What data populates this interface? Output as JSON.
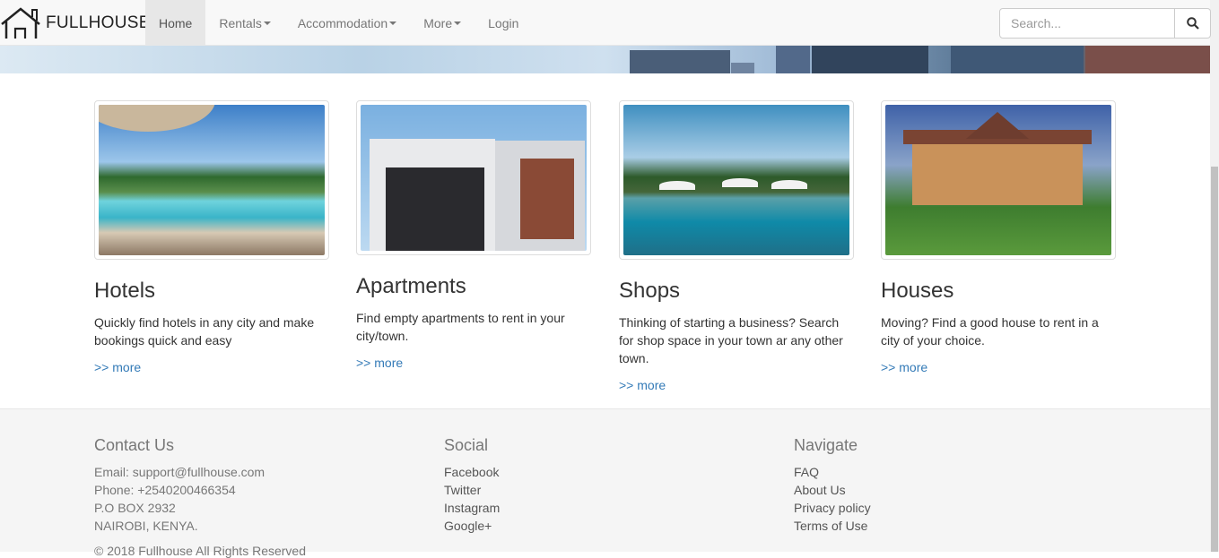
{
  "brand": {
    "name": "FULLHOUSE",
    "icon": "house-outline-icon"
  },
  "nav": {
    "items": [
      {
        "label": "Home",
        "active": true,
        "dropdown": false
      },
      {
        "label": "Rentals",
        "active": false,
        "dropdown": true
      },
      {
        "label": "Accommodation",
        "active": false,
        "dropdown": true
      },
      {
        "label": "More",
        "active": false,
        "dropdown": true
      },
      {
        "label": "Login",
        "active": false,
        "dropdown": false
      }
    ]
  },
  "search": {
    "placeholder": "Search...",
    "value": "",
    "icon": "search-icon"
  },
  "cards": [
    {
      "title": "Hotels",
      "text": "Quickly find hotels in any city and make bookings quick and easy",
      "link": ">> more",
      "image": "hotel-pool-photo"
    },
    {
      "title": "Apartments",
      "text": "Find empty apartments to rent in your city/town.",
      "link": ">> more",
      "image": "modern-apartment-photo"
    },
    {
      "title": "Shops",
      "text": "Thinking of starting a business? Search for shop space in your town ar any other town.",
      "link": ">> more",
      "image": "resort-pool-photo"
    },
    {
      "title": "Houses",
      "text": "Moving? Find a good house to rent in a city of your choice.",
      "link": ">> more",
      "image": "brick-house-photo"
    }
  ],
  "footer": {
    "contact": {
      "heading": "Contact Us",
      "lines": [
        "Email: support@fullhouse.com",
        "Phone: +2540200466354",
        "P.O BOX 2932",
        "NAIROBI, KENYA."
      ]
    },
    "social": {
      "heading": "Social",
      "links": [
        "Facebook",
        "Twitter",
        "Instagram",
        "Google+"
      ]
    },
    "navigate": {
      "heading": "Navigate",
      "links": [
        "FAQ",
        "About Us",
        "Privacy policy",
        "Terms of Use"
      ]
    },
    "copyright": "© 2018 Fullhouse All Rights Reserved"
  },
  "colors": {
    "link": "#337ab7",
    "navbar_bg": "#f8f8f8",
    "footer_bg": "#f5f5f5"
  }
}
